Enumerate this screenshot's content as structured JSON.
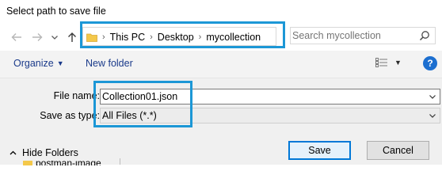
{
  "window": {
    "title": "Select path to save file"
  },
  "nav": {
    "back_icon": "back-arrow-icon",
    "forward_icon": "forward-arrow-icon",
    "recent_icon": "chevron-down-icon",
    "up_icon": "up-arrow-icon"
  },
  "address": {
    "breadcrumbs": [
      "This PC",
      "Desktop",
      "mycollection"
    ]
  },
  "search": {
    "placeholder": "Search mycollection"
  },
  "toolbar": {
    "organize_label": "Organize",
    "new_folder_label": "New folder",
    "help_label": "?"
  },
  "form": {
    "file_name_label": "File name:",
    "file_name_value": "Collection01.json",
    "save_as_type_label": "Save as type:",
    "save_as_type_value": "All Files (*.*)"
  },
  "footer": {
    "hide_folders_label": "Hide Folders",
    "folder_peek_label": "postman-image",
    "save_label": "Save",
    "cancel_label": "Cancel"
  },
  "colors": {
    "highlight": "#1c97d6",
    "link": "#1a3a8a",
    "panel": "#f0f0f0",
    "primary_button_border": "#0078d7"
  }
}
